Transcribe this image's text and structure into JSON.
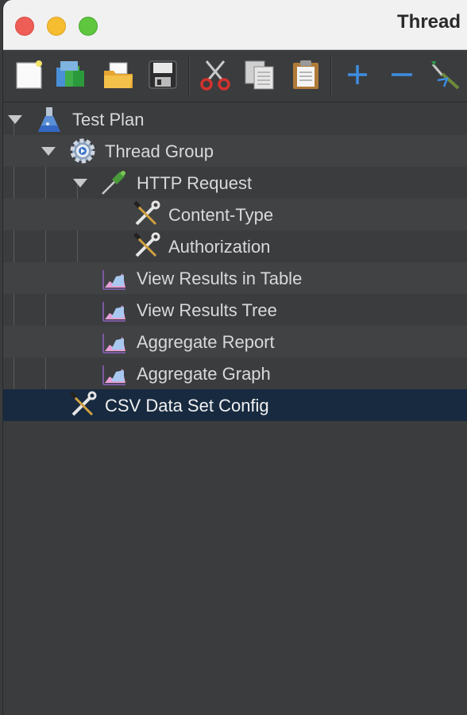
{
  "window": {
    "title": "Thread"
  },
  "toolbar": {
    "buttons": [
      {
        "name": "new-icon"
      },
      {
        "name": "templates-icon"
      },
      {
        "name": "open-icon"
      },
      {
        "name": "save-icon"
      },
      {
        "name": "cut-icon"
      },
      {
        "name": "copy-icon"
      },
      {
        "name": "paste-icon"
      },
      {
        "name": "expand-all-icon"
      },
      {
        "name": "collapse-all-icon"
      },
      {
        "name": "toggle-icon"
      }
    ]
  },
  "tree": {
    "items": [
      {
        "label": "Test Plan",
        "icon": "test-plan-icon",
        "expanded": true
      },
      {
        "label": "Thread Group",
        "icon": "thread-group-gear-icon",
        "expanded": true
      },
      {
        "label": "HTTP Request",
        "icon": "sampler-pipette-icon",
        "expanded": true
      },
      {
        "label": "Content-Type",
        "icon": "config-tools-icon"
      },
      {
        "label": "Authorization",
        "icon": "config-tools-icon"
      },
      {
        "label": "View Results in Table",
        "icon": "listener-chart-icon"
      },
      {
        "label": "View Results Tree",
        "icon": "listener-chart-icon"
      },
      {
        "label": "Aggregate Report",
        "icon": "listener-chart-icon"
      },
      {
        "label": "Aggregate Graph",
        "icon": "listener-chart-icon"
      },
      {
        "label": "CSV Data Set Config",
        "icon": "config-tools-icon",
        "selected": true
      }
    ]
  },
  "colors": {
    "background": "#3b3c3e",
    "selection": "#172a40",
    "text": "#d9d9d9"
  }
}
